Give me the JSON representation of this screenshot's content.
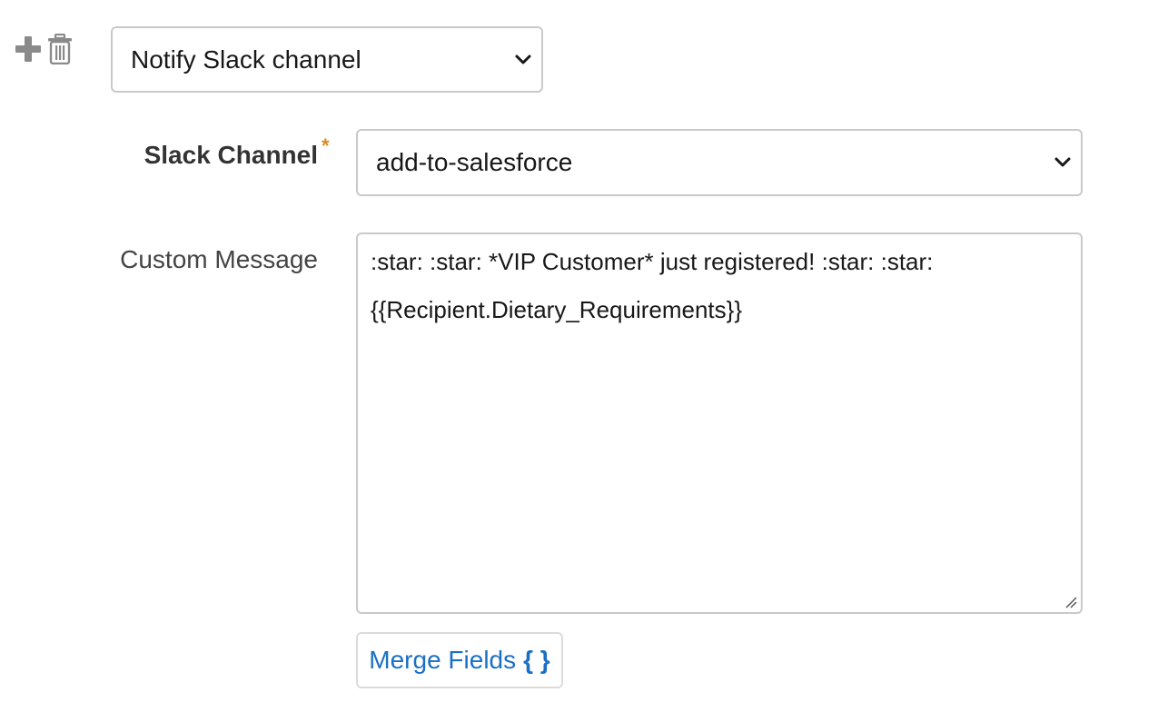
{
  "action": {
    "plus_icon": "plus-icon",
    "trash_icon": "trash-icon",
    "selected_action": "Notify Slack channel"
  },
  "slack_channel": {
    "label": "Slack Channel",
    "required_marker": "*",
    "selected_value": "add-to-salesforce"
  },
  "custom_message": {
    "label": "Custom Message",
    "lines": [
      ":star: :star: *VIP Customer* just registered! :star: :star:",
      "{{Recipient.Dietary_Requirements}}"
    ]
  },
  "merge_fields": {
    "label": "Merge Fields",
    "icon_text": "{ }"
  },
  "colors": {
    "accent_blue": "#1b6fc5",
    "required_orange": "#d88a2b",
    "border_gray": "#c9c9c9",
    "icon_gray": "#8a8a8a"
  }
}
